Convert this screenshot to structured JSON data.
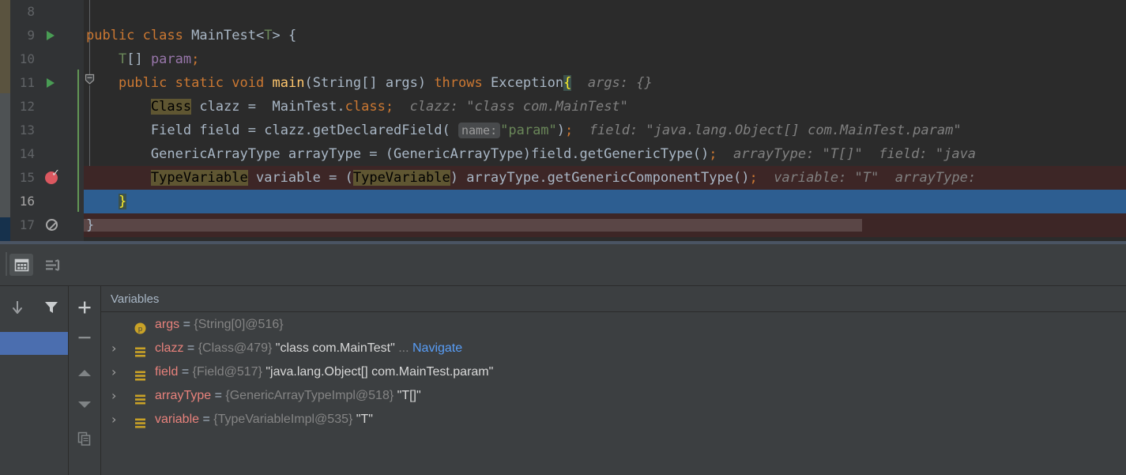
{
  "editor": {
    "font_size": 17,
    "background": "#2b2b2b",
    "gutter_background": "#313335",
    "lines": [
      {
        "num": "8",
        "text": ""
      },
      {
        "num": "9",
        "text": "public class MainTest<T> {"
      },
      {
        "num": "10",
        "text": "    T[] param;"
      },
      {
        "num": "11",
        "text": "    public static void main(String[] args) throws Exception{"
      },
      {
        "num": "12",
        "text": "        Class clazz =  MainTest.class;"
      },
      {
        "num": "13",
        "text": "        Field field = clazz.getDeclaredField( \"param\");"
      },
      {
        "num": "14",
        "text": "        GenericArrayType arrayType = (GenericArrayType)field.getGenericType();"
      },
      {
        "num": "15",
        "text": "        TypeVariable variable = (TypeVariable) arrayType.getGenericComponentType();"
      },
      {
        "num": "16",
        "text": "    }"
      },
      {
        "num": "17",
        "text": "}"
      }
    ],
    "inline_hints": {
      "line11": "args: {}",
      "line12": "clazz: \"class com.MainTest\"",
      "line13": "field: \"java.lang.Object[] com.MainTest.param\"",
      "line14_a": "arrayType: \"T[]\"",
      "line14_b": "field: \"java",
      "line15_a": "variable: \"T\"",
      "line15_b": "arrayType:"
    },
    "param_hints": {
      "line13_name": "name:"
    },
    "tokens": {
      "l9": {
        "kw1": "public",
        "kw2": "class",
        "cls": "MainTest",
        "lt": "<",
        "generic": "T",
        "gt": ">",
        "brace": "{"
      },
      "l10": {
        "type": "T",
        "brackets": "[]",
        "field": "param",
        "semi": ";"
      },
      "l11": {
        "kw1": "public",
        "kw2": "static",
        "kw3": "void",
        "fn": "main",
        "lp": "(",
        "type": "String",
        "brackets": "[]",
        "arg": "args",
        "rp": ")",
        "kw4": "throws",
        "exc": "Exception",
        "brace": "{"
      },
      "l12": {
        "type": "Class",
        "var": "clazz",
        "eq": "=",
        "cls": "MainTest",
        "dot": ".",
        "kw": "class",
        "semi": ";"
      },
      "l13": {
        "type": "Field",
        "var": "field",
        "eq": "=",
        "recv": "clazz",
        "dot": ".",
        "method": "getDeclaredField",
        "lp": "(",
        "str": "\"param\"",
        "rp": ")",
        "semi": ";"
      },
      "l14": {
        "type": "GenericArrayType",
        "var": "arrayType",
        "eq": "=",
        "cast": "(GenericArrayType)",
        "recv": "field",
        "dot": ".",
        "method": "getGenericType",
        "parens": "()",
        "semi": ";"
      },
      "l15": {
        "type": "TypeVariable",
        "var": "variable",
        "eq": "=",
        "castl": "(",
        "castt": "TypeVariable",
        "castr": ")",
        "recv": "arrayType",
        "dot": ".",
        "method": "getGenericComponentType",
        "parens": "()",
        "semi": ";"
      },
      "l16": {
        "brace": "}"
      },
      "l17": {
        "brace": "}"
      }
    },
    "gutter_icons": {
      "run_arrow_lines": [
        "9",
        "11"
      ],
      "breakpoint_line": "15",
      "no_entry_line": "17",
      "fold_lines": [
        "11",
        "16"
      ]
    },
    "colors": {
      "keyword": "#cc7832",
      "identifier": "#a9b7c6",
      "method_decl": "#ffc66d",
      "field": "#9876aa",
      "string": "#6a8759",
      "generic": "#6a8759",
      "inline_hint": "#808080",
      "selection": "#2d5e91",
      "error_line": "#3d2626",
      "breakpoint": "#db5860",
      "run_arrow": "#499c54",
      "brace_match_bg": "#3b514d",
      "brace_match_fg": "#ffef28",
      "identifier_highlight": "#5f5632"
    }
  },
  "debug_panel": {
    "toolbar": {
      "buttons": [
        {
          "name": "table-view",
          "icon": "table-icon",
          "active": true
        },
        {
          "name": "group-by",
          "icon": "group-lines-icon",
          "active": false
        }
      ]
    },
    "left_toolbar": {
      "buttons": [
        {
          "name": "step-down",
          "icon": "arrow-down-icon"
        },
        {
          "name": "filter",
          "icon": "funnel-icon"
        }
      ]
    },
    "watch_toolbar": {
      "buttons": [
        {
          "name": "add-watch",
          "icon": "plus-icon"
        },
        {
          "name": "remove-watch",
          "icon": "minus-icon"
        },
        {
          "name": "move-up",
          "icon": "triangle-up-icon"
        },
        {
          "name": "move-down",
          "icon": "triangle-down-icon"
        },
        {
          "name": "copy-value",
          "icon": "copy-icon"
        }
      ]
    },
    "variables": {
      "header": "Variables",
      "rows": [
        {
          "expandable": false,
          "icon": "parameter-p-icon",
          "name": "args",
          "eq": "=",
          "type": "{String[0]@516}",
          "value": "",
          "navigate": "",
          "dots": ""
        },
        {
          "expandable": true,
          "icon": "value-stack-icon",
          "name": "clazz",
          "eq": "=",
          "type": "{Class@479}",
          "value": "\"class com.MainTest\"",
          "dots": "...",
          "navigate": "Navigate"
        },
        {
          "expandable": true,
          "icon": "value-stack-icon",
          "name": "field",
          "eq": "=",
          "type": "{Field@517}",
          "value": "\"java.lang.Object[] com.MainTest.param\"",
          "navigate": "",
          "dots": ""
        },
        {
          "expandable": true,
          "icon": "value-stack-icon",
          "name": "arrayType",
          "eq": "=",
          "type": "{GenericArrayTypeImpl@518}",
          "value": "\"T[]\"",
          "navigate": "",
          "dots": ""
        },
        {
          "expandable": true,
          "icon": "value-stack-icon",
          "name": "variable",
          "eq": "=",
          "type": "{TypeVariableImpl@535}",
          "value": "\"T\"",
          "navigate": "",
          "dots": ""
        }
      ]
    },
    "colors": {
      "panel_bg": "#3c3f41",
      "var_name": "#e8827c",
      "var_type": "#848484",
      "var_value": "#d8d8d8",
      "navigate_link": "#589df6",
      "selected_row": "#4b6eaf"
    }
  }
}
